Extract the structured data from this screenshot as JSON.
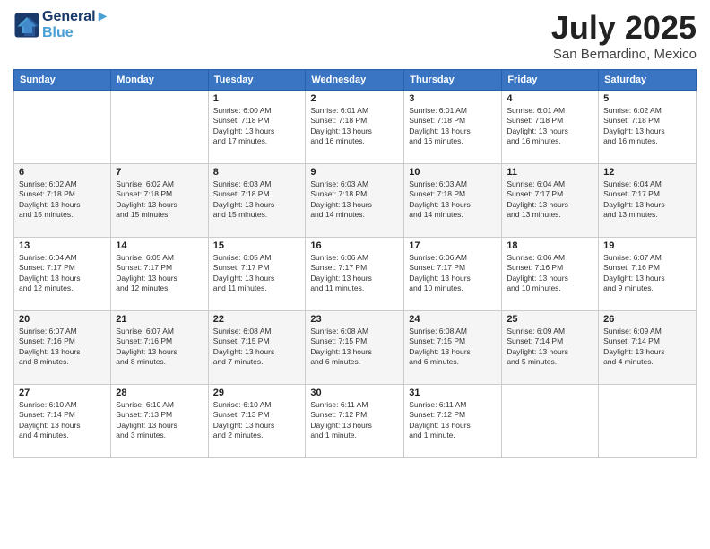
{
  "header": {
    "logo_line1": "General",
    "logo_line2": "Blue",
    "month_year": "July 2025",
    "location": "San Bernardino, Mexico"
  },
  "weekdays": [
    "Sunday",
    "Monday",
    "Tuesday",
    "Wednesday",
    "Thursday",
    "Friday",
    "Saturday"
  ],
  "weeks": [
    [
      {
        "day": "",
        "info": ""
      },
      {
        "day": "",
        "info": ""
      },
      {
        "day": "1",
        "info": "Sunrise: 6:00 AM\nSunset: 7:18 PM\nDaylight: 13 hours\nand 17 minutes."
      },
      {
        "day": "2",
        "info": "Sunrise: 6:01 AM\nSunset: 7:18 PM\nDaylight: 13 hours\nand 16 minutes."
      },
      {
        "day": "3",
        "info": "Sunrise: 6:01 AM\nSunset: 7:18 PM\nDaylight: 13 hours\nand 16 minutes."
      },
      {
        "day": "4",
        "info": "Sunrise: 6:01 AM\nSunset: 7:18 PM\nDaylight: 13 hours\nand 16 minutes."
      },
      {
        "day": "5",
        "info": "Sunrise: 6:02 AM\nSunset: 7:18 PM\nDaylight: 13 hours\nand 16 minutes."
      }
    ],
    [
      {
        "day": "6",
        "info": "Sunrise: 6:02 AM\nSunset: 7:18 PM\nDaylight: 13 hours\nand 15 minutes."
      },
      {
        "day": "7",
        "info": "Sunrise: 6:02 AM\nSunset: 7:18 PM\nDaylight: 13 hours\nand 15 minutes."
      },
      {
        "day": "8",
        "info": "Sunrise: 6:03 AM\nSunset: 7:18 PM\nDaylight: 13 hours\nand 15 minutes."
      },
      {
        "day": "9",
        "info": "Sunrise: 6:03 AM\nSunset: 7:18 PM\nDaylight: 13 hours\nand 14 minutes."
      },
      {
        "day": "10",
        "info": "Sunrise: 6:03 AM\nSunset: 7:18 PM\nDaylight: 13 hours\nand 14 minutes."
      },
      {
        "day": "11",
        "info": "Sunrise: 6:04 AM\nSunset: 7:17 PM\nDaylight: 13 hours\nand 13 minutes."
      },
      {
        "day": "12",
        "info": "Sunrise: 6:04 AM\nSunset: 7:17 PM\nDaylight: 13 hours\nand 13 minutes."
      }
    ],
    [
      {
        "day": "13",
        "info": "Sunrise: 6:04 AM\nSunset: 7:17 PM\nDaylight: 13 hours\nand 12 minutes."
      },
      {
        "day": "14",
        "info": "Sunrise: 6:05 AM\nSunset: 7:17 PM\nDaylight: 13 hours\nand 12 minutes."
      },
      {
        "day": "15",
        "info": "Sunrise: 6:05 AM\nSunset: 7:17 PM\nDaylight: 13 hours\nand 11 minutes."
      },
      {
        "day": "16",
        "info": "Sunrise: 6:06 AM\nSunset: 7:17 PM\nDaylight: 13 hours\nand 11 minutes."
      },
      {
        "day": "17",
        "info": "Sunrise: 6:06 AM\nSunset: 7:17 PM\nDaylight: 13 hours\nand 10 minutes."
      },
      {
        "day": "18",
        "info": "Sunrise: 6:06 AM\nSunset: 7:16 PM\nDaylight: 13 hours\nand 10 minutes."
      },
      {
        "day": "19",
        "info": "Sunrise: 6:07 AM\nSunset: 7:16 PM\nDaylight: 13 hours\nand 9 minutes."
      }
    ],
    [
      {
        "day": "20",
        "info": "Sunrise: 6:07 AM\nSunset: 7:16 PM\nDaylight: 13 hours\nand 8 minutes."
      },
      {
        "day": "21",
        "info": "Sunrise: 6:07 AM\nSunset: 7:16 PM\nDaylight: 13 hours\nand 8 minutes."
      },
      {
        "day": "22",
        "info": "Sunrise: 6:08 AM\nSunset: 7:15 PM\nDaylight: 13 hours\nand 7 minutes."
      },
      {
        "day": "23",
        "info": "Sunrise: 6:08 AM\nSunset: 7:15 PM\nDaylight: 13 hours\nand 6 minutes."
      },
      {
        "day": "24",
        "info": "Sunrise: 6:08 AM\nSunset: 7:15 PM\nDaylight: 13 hours\nand 6 minutes."
      },
      {
        "day": "25",
        "info": "Sunrise: 6:09 AM\nSunset: 7:14 PM\nDaylight: 13 hours\nand 5 minutes."
      },
      {
        "day": "26",
        "info": "Sunrise: 6:09 AM\nSunset: 7:14 PM\nDaylight: 13 hours\nand 4 minutes."
      }
    ],
    [
      {
        "day": "27",
        "info": "Sunrise: 6:10 AM\nSunset: 7:14 PM\nDaylight: 13 hours\nand 4 minutes."
      },
      {
        "day": "28",
        "info": "Sunrise: 6:10 AM\nSunset: 7:13 PM\nDaylight: 13 hours\nand 3 minutes."
      },
      {
        "day": "29",
        "info": "Sunrise: 6:10 AM\nSunset: 7:13 PM\nDaylight: 13 hours\nand 2 minutes."
      },
      {
        "day": "30",
        "info": "Sunrise: 6:11 AM\nSunset: 7:12 PM\nDaylight: 13 hours\nand 1 minute."
      },
      {
        "day": "31",
        "info": "Sunrise: 6:11 AM\nSunset: 7:12 PM\nDaylight: 13 hours\nand 1 minute."
      },
      {
        "day": "",
        "info": ""
      },
      {
        "day": "",
        "info": ""
      }
    ]
  ]
}
